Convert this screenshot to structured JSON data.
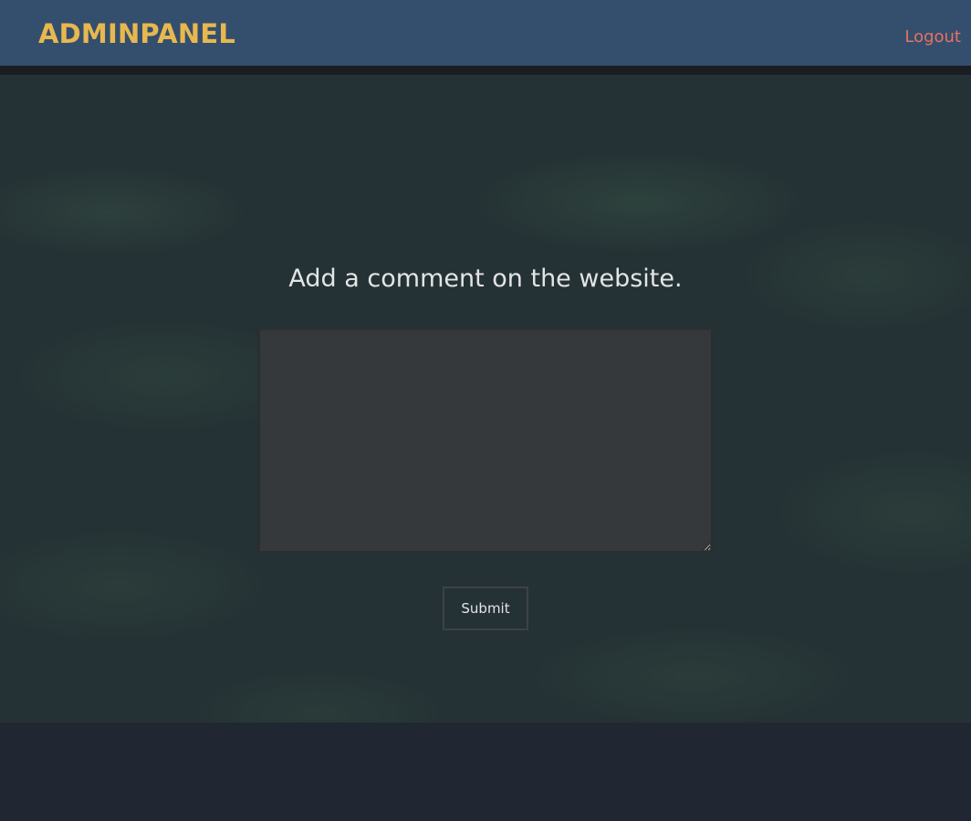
{
  "header": {
    "brand": "ADMINPANEL",
    "logout_label": "Logout"
  },
  "main": {
    "heading": "Add a comment on the website.",
    "comment": {
      "value": "",
      "placeholder": ""
    },
    "submit_label": "Submit"
  },
  "colors": {
    "header_bg": "#344e6e",
    "brand": "#e7b84e",
    "logout": "#e6735f",
    "page_bg": "#212732",
    "textarea_bg": "#35393c"
  }
}
